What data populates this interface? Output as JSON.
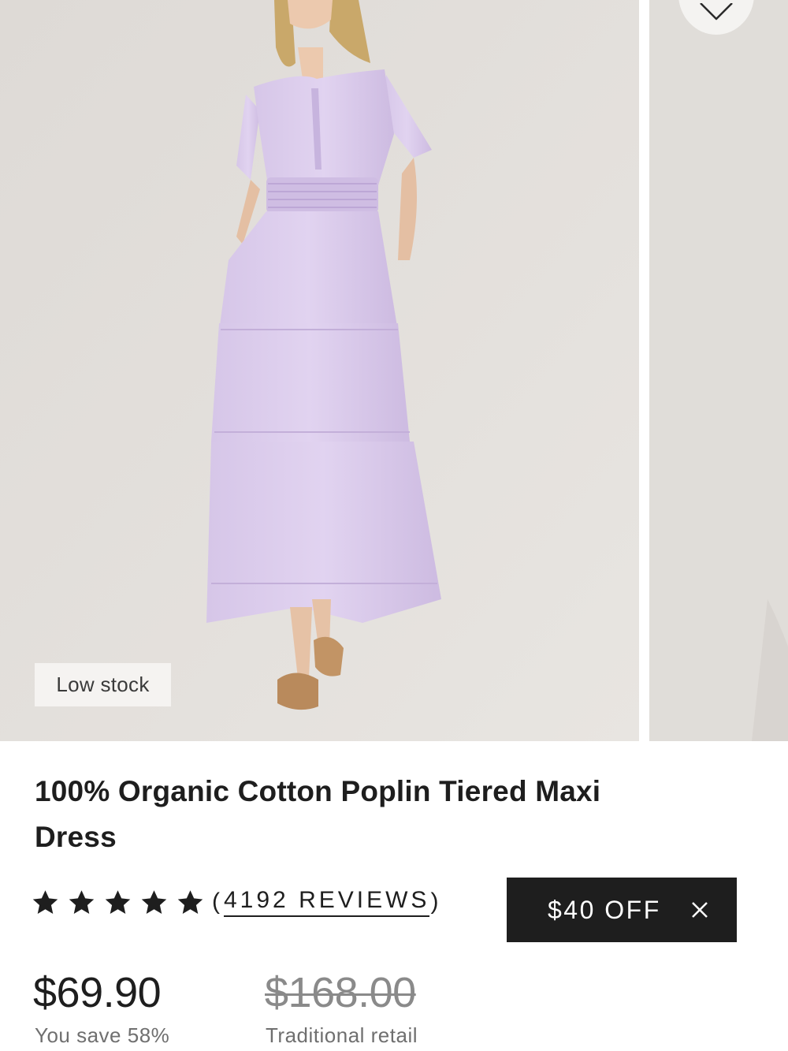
{
  "gallery": {
    "main_image_alt": "",
    "badge": "Low stock",
    "favorite_icon": "heart-icon"
  },
  "product": {
    "title": "100% Organic Cotton Poplin Tiered Maxi Dress",
    "rating": {
      "value": 5,
      "max": 5,
      "star_icon": "star-icon",
      "open_paren": "(",
      "reviews_label": "4192 REVIEWS",
      "close_paren": ")"
    },
    "promo": {
      "label": "$40 OFF",
      "close_icon": "close-icon"
    },
    "price": "$69.90",
    "savings": "You save 58%",
    "retail_price": "$168.00",
    "retail_label": "Traditional retail"
  },
  "colors": {
    "dress": "#d9c9ea",
    "backdrop": "#e3e0dc",
    "promo_bg": "#1e1e1e",
    "text": "#1e1e1e",
    "muted_text": "#6f6f6f"
  }
}
